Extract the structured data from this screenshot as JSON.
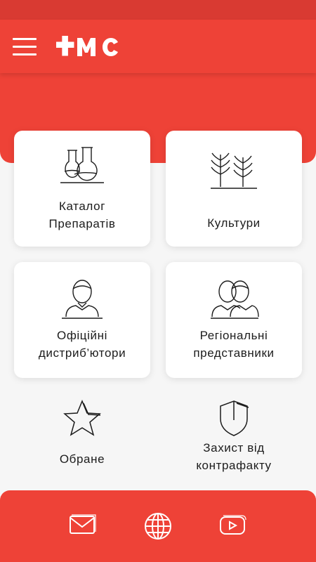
{
  "colors": {
    "brand_red": "#ee4237",
    "status_red": "#d93a32",
    "background": "#f6f6f6",
    "card": "#ffffff",
    "text": "#1c1c1c"
  },
  "header": {
    "menu_icon": "hamburger-menu-icon",
    "logo": "FMC"
  },
  "tiles": [
    {
      "lines": [
        "Каталог",
        "Препаратів"
      ],
      "icon": "flasks-icon"
    },
    {
      "lines": [
        "Культури"
      ],
      "icon": "crops-icon"
    },
    {
      "lines": [
        "Офіційні",
        "дистриб’ютори"
      ],
      "icon": "person-icon"
    },
    {
      "lines": [
        "Регіональні",
        "представники"
      ],
      "icon": "people-icon"
    },
    {
      "lines": [
        "Обране"
      ],
      "icon": "star-icon"
    },
    {
      "lines": [
        "Захист від",
        "контрафакту"
      ],
      "icon": "shield-icon"
    }
  ],
  "bottom_bar": {
    "icons": [
      "mail-icon",
      "globe-icon",
      "youtube-icon"
    ]
  }
}
